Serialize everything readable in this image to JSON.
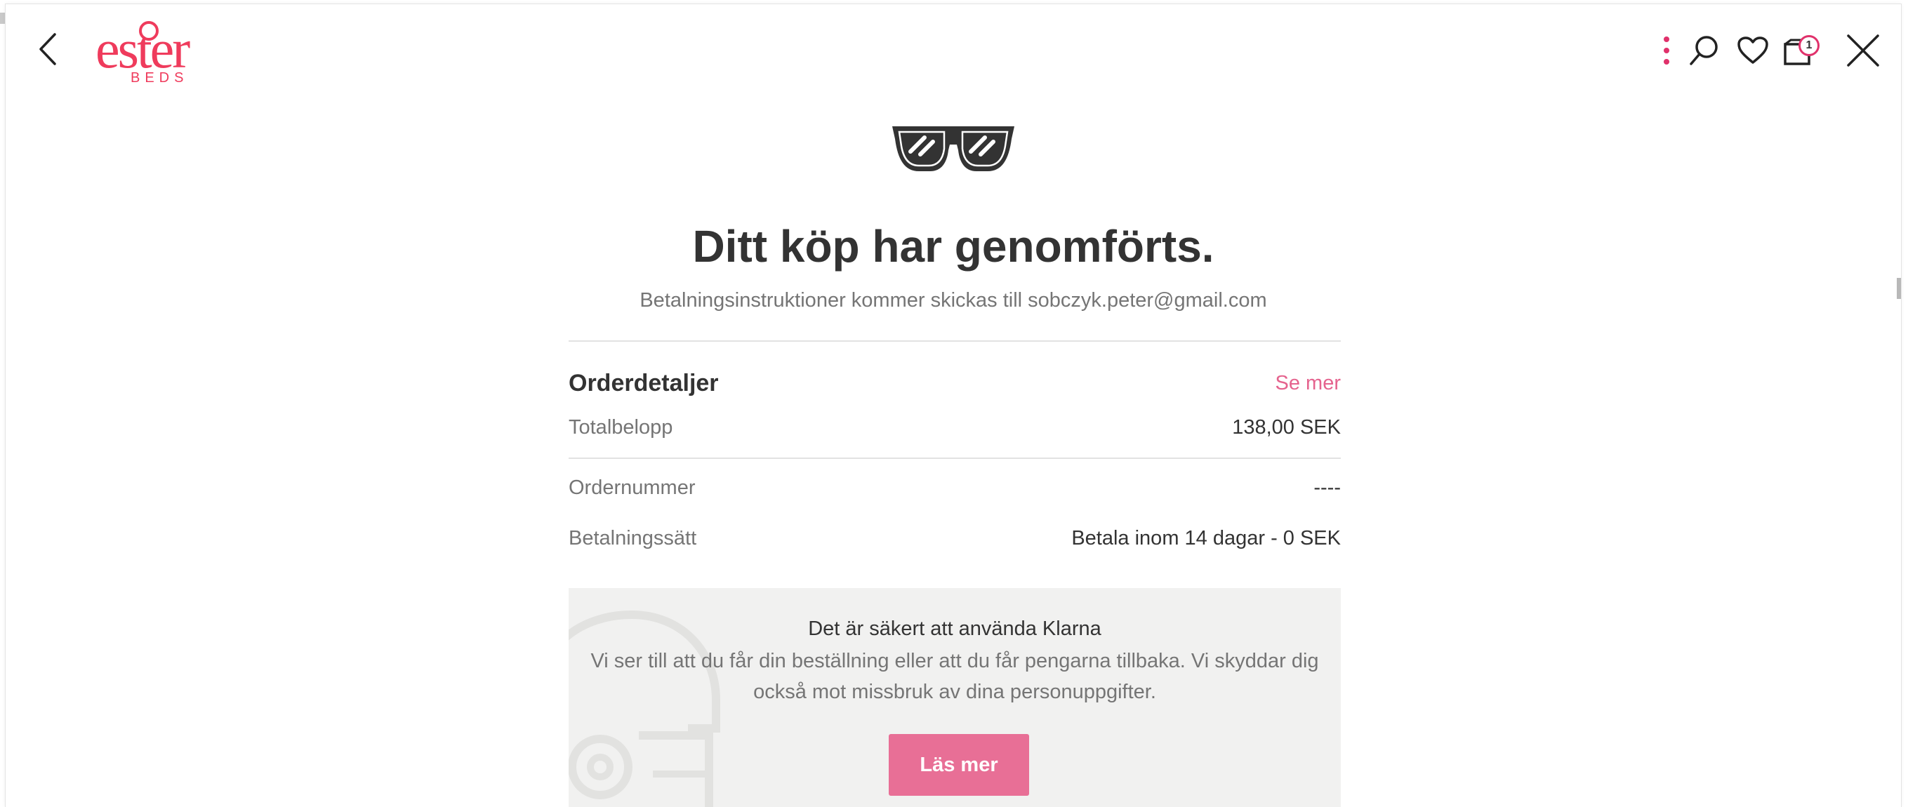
{
  "header": {
    "logo_text": "ester",
    "logo_subtext": "BEDS",
    "cart_count": "1",
    "icons": [
      "chevron-left-icon",
      "more-vertical-icon",
      "search-icon",
      "heart-icon",
      "cart-icon",
      "close-icon"
    ],
    "accent_color": "#ef3b5c"
  },
  "confirmation": {
    "title": "Ditt köp har genomförts.",
    "subtitle": "Betalningsinstruktioner kommer skickas till sobczyk.peter@gmail.com"
  },
  "order": {
    "heading": "Orderdetaljer",
    "see_more": "Se mer",
    "total_label": "Totalbelopp",
    "total_value": "138,00 SEK",
    "order_number_label": "Ordernummer",
    "order_number_value": "----",
    "payment_method_label": "Betalningssätt",
    "payment_method_value": "Betala inom 14 dagar - 0 SEK"
  },
  "klarna": {
    "title": "Det är säkert att använda Klarna",
    "text": "Vi ser till att du får din beställning eller att du får pengarna tillbaka. Vi skyddar dig också mot missbruk av dina personuppgifter.",
    "button_label": "Läs mer",
    "button_color": "#e86f96"
  }
}
